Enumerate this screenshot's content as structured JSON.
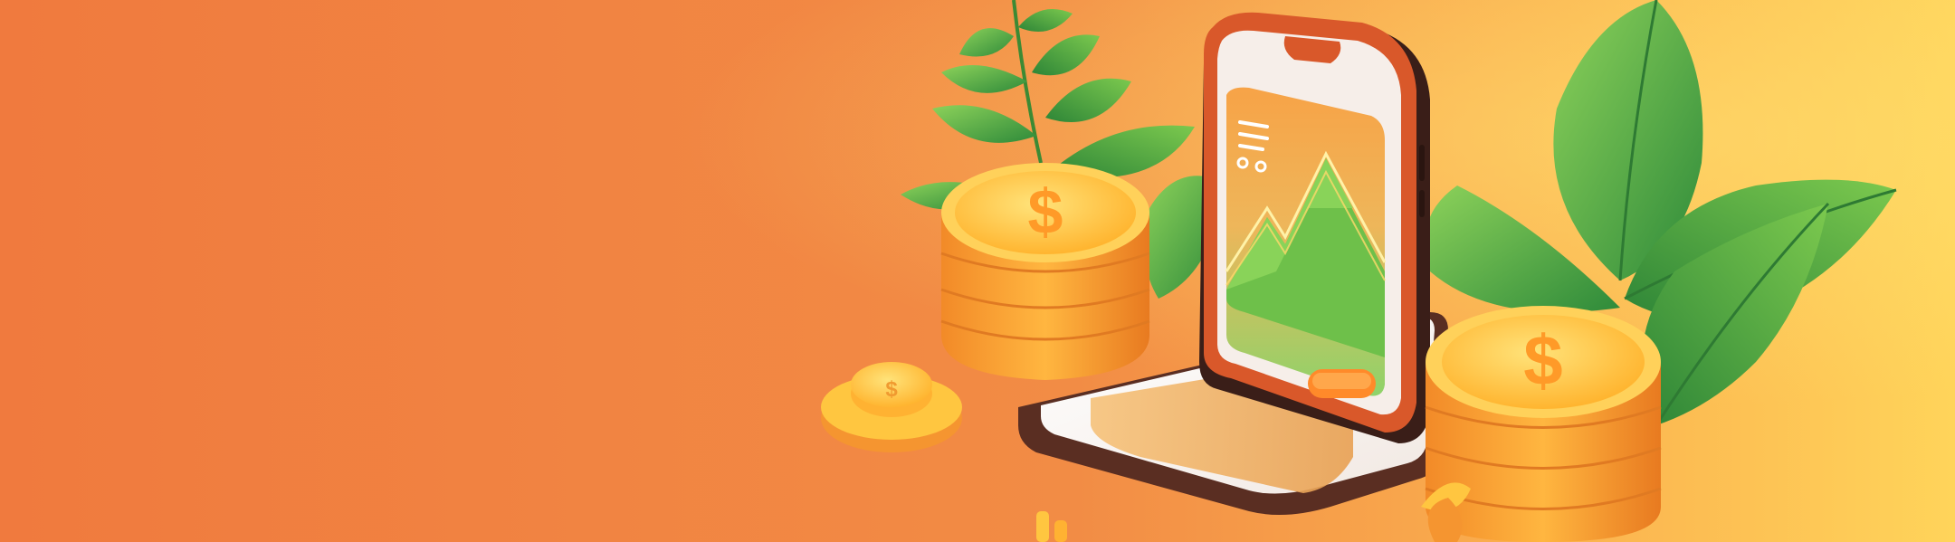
{
  "image": {
    "kind": "illustration",
    "theme": "fintech / savings",
    "colors": {
      "background_left": "#F07A3E",
      "background_right": "#FFD45A",
      "coin_gold": "#FFC640",
      "coin_orange": "#FF9B2F",
      "leaf_green": "#4FAE3E",
      "phone_frame": "#D9582A",
      "chart_green": "#7DCB4C"
    },
    "icons": [
      "dollar-coin-stack-icon",
      "smartphone-icon",
      "growth-chart-icon",
      "leaf-icon",
      "menu-lines-icon"
    ]
  }
}
